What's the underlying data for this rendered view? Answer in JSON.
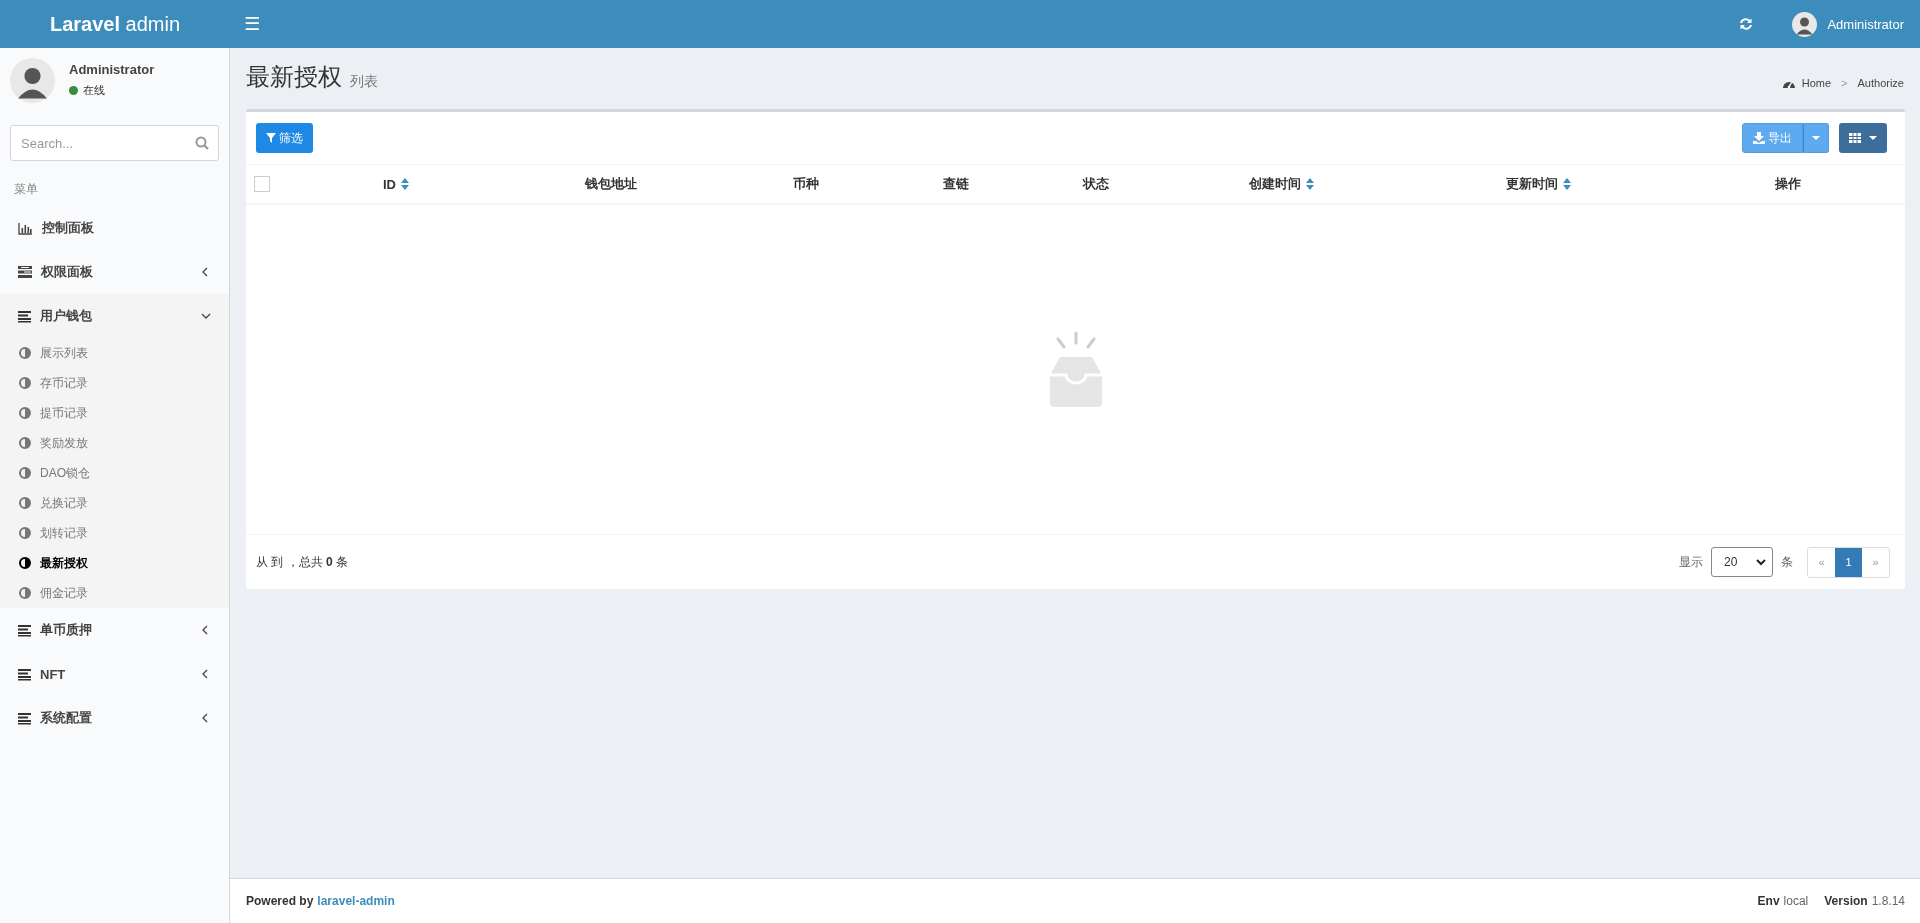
{
  "header": {
    "logo": "**Laravel** admin",
    "menu_toggle": "☰",
    "user_name": "Administrator"
  },
  "sidebar": {
    "user": {
      "name": "Administrator",
      "status": "在线"
    },
    "search": {
      "placeholder": "Search..."
    },
    "menu_header": "菜单",
    "items": [
      {
        "label": "控制面板",
        "kind": "link"
      },
      {
        "label": "权限面板",
        "kind": "tree",
        "expanded": false
      },
      {
        "label": "用户钱包",
        "kind": "tree",
        "expanded": true,
        "children": [
          {
            "label": "展示列表",
            "selected": false
          },
          {
            "label": "存币记录",
            "selected": false
          },
          {
            "label": "提币记录",
            "selected": false
          },
          {
            "label": "奖励发放",
            "selected": false
          },
          {
            "label": "DAO锁仓",
            "selected": false
          },
          {
            "label": "兑换记录",
            "selected": false
          },
          {
            "label": "划转记录",
            "selected": false
          },
          {
            "label": "最新授权",
            "selected": true
          },
          {
            "label": "佣金记录",
            "selected": false
          }
        ]
      },
      {
        "label": "单币质押",
        "kind": "tree",
        "expanded": false
      },
      {
        "label": "NFT",
        "kind": "tree",
        "expanded": false
      },
      {
        "label": "系统配置",
        "kind": "tree",
        "expanded": false
      }
    ]
  },
  "page": {
    "title": "最新授权",
    "subtitle": "列表",
    "breadcrumb": [
      "Home",
      "Authorize"
    ],
    "breadcrumb_separator": ">"
  },
  "toolbar": {
    "filter": "筛选",
    "export": "导出"
  },
  "table": {
    "columns": [
      {
        "label": "ID",
        "sortable": true
      },
      {
        "label": "钱包地址",
        "sortable": false
      },
      {
        "label": "币种",
        "sortable": false
      },
      {
        "label": "查链",
        "sortable": false
      },
      {
        "label": "状态",
        "sortable": false
      },
      {
        "label": "创建时间",
        "sortable": true
      },
      {
        "label": "更新时间",
        "sortable": true
      },
      {
        "label": "操作",
        "sortable": false
      }
    ],
    "all_checked": false
  },
  "pager": {
    "summary": "从 到 ，总共 **0** 条",
    "show_label": "显示",
    "per_page": "20",
    "unit": "条",
    "prev": "«",
    "pages": [
      {
        "label": "1",
        "selected": true
      }
    ],
    "next": "»"
  },
  "footer": {
    "powered": "Powered by",
    "link": "laravel-admin",
    "env_label": "Env",
    "env": "local",
    "version_label": "Version",
    "version": "1.8.14"
  }
}
